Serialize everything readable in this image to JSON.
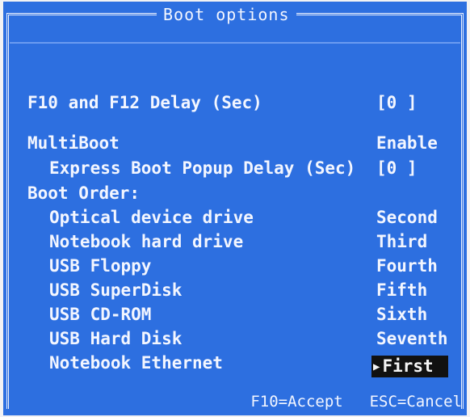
{
  "window": {
    "title": "Boot options"
  },
  "settings": {
    "delay_label": "F10 and F12 Delay (Sec)",
    "delay_value": "[0 ]",
    "multiboot_label": "MultiBoot",
    "multiboot_value": "Enable",
    "express_label": "Express Boot Popup Delay (Sec)",
    "express_value": "[0 ]",
    "boot_order_heading": "Boot Order:"
  },
  "boot_order": [
    {
      "label": "Optical device drive",
      "value": "Second"
    },
    {
      "label": "Notebook hard drive",
      "value": "Third"
    },
    {
      "label": "USB Floppy",
      "value": "Fourth"
    },
    {
      "label": "USB SuperDisk",
      "value": "Fifth"
    },
    {
      "label": "USB CD-ROM",
      "value": "Sixth"
    },
    {
      "label": "USB Hard Disk",
      "value": "Seventh"
    },
    {
      "label": "Notebook Ethernet",
      "value": "First"
    }
  ],
  "selection": {
    "pointer_icon": "right-triangle-icon",
    "pointer_symbol": "▶"
  },
  "footer": {
    "accept": "F10=Accept",
    "cancel": "ESC=Cancel"
  },
  "colors": {
    "background": "#2d6fe0",
    "foreground": "#f3f6ff",
    "selection_background": "#111111",
    "outer_frame": "#f2f2f4"
  }
}
